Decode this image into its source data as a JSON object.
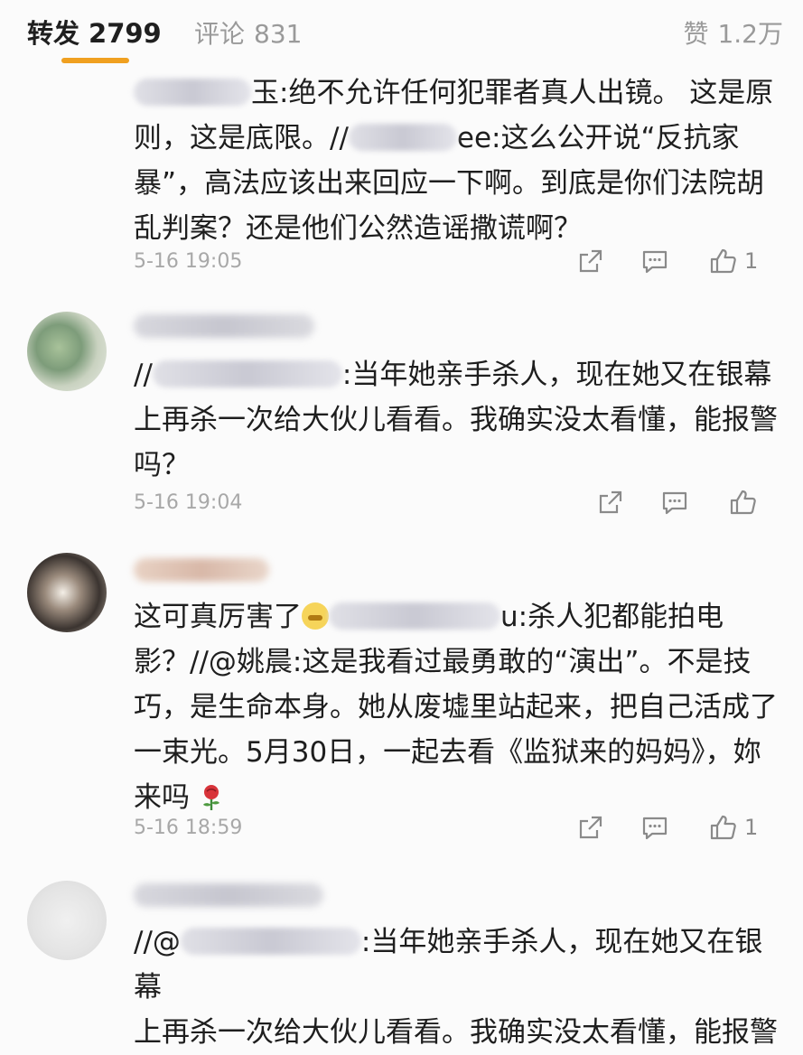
{
  "tabs": {
    "repost_label": "转发",
    "repost_count": "2799",
    "comment_label": "评论",
    "comment_count": "831",
    "like_label": "赞",
    "like_count": "1.2万"
  },
  "comments": [
    {
      "lines": [
        "玉:绝不允许任何犯罪者真人出镜。 这是原",
        "则，这是底限。//",
        "ee:这么公开说“反抗家",
        "暴”，高法应该出来回应一下啊。到底是你们法院胡",
        "乱判案？还是他们公然造谣撒谎啊？"
      ],
      "time": "5-16 19:05",
      "like_count": "1"
    },
    {
      "line1_tail": ":当年她亲手杀人，现在她又在银幕",
      "line1_head": "//",
      "line2": "上再杀一次给大伙儿看看。我确实没太看懂，能报警",
      "line3": "吗？",
      "time": "5-16 19:04",
      "like_count": ""
    },
    {
      "line1_head": "这可真厉害了",
      "line1_tail": "u:杀人犯都能拍电",
      "line2": "影？//@姚晨:这是我看过最勇敢的“演出”。不是技",
      "line3": "巧，是生命本身。她从废墟里站起来，把自己活成了",
      "line4": "一束光。5月30日，一起去看《监狱来的妈妈》，妳",
      "line5": "来吗",
      "time": "5-16 18:59",
      "like_count": "1"
    },
    {
      "line1_head": "//@",
      "line1_tail": ":当年她亲手杀人，现在她又在银幕",
      "line2": "上再杀一次给大伙儿看看。我确实没太看懂，能报警"
    }
  ],
  "icons": {
    "share": "share-icon",
    "comment": "comment-icon",
    "like": "thumbs-up-icon",
    "rose": "rose-icon"
  },
  "colors": {
    "accent": "#f0a020",
    "muted": "#9a9a9a"
  }
}
